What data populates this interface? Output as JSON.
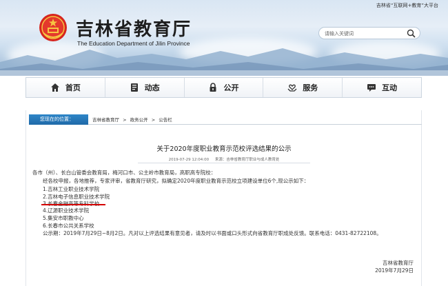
{
  "header": {
    "top_link": "吉林省“互联网+教育”大平台",
    "site_title": "吉林省教育厅",
    "site_subtitle": "The Education Department of Jilin Province",
    "search_placeholder": "请输入关键词"
  },
  "nav": {
    "items": [
      {
        "label": "首页",
        "icon": "home-icon"
      },
      {
        "label": "动态",
        "icon": "document-icon"
      },
      {
        "label": "公开",
        "icon": "lock-icon"
      },
      {
        "label": "服务",
        "icon": "hands-heart-icon"
      },
      {
        "label": "互动",
        "icon": "chat-icon"
      }
    ]
  },
  "breadcrumb": {
    "label": "您现在的位置：",
    "links": [
      "吉林省教育厅",
      "政务公开",
      "公告栏"
    ],
    "separator": ">"
  },
  "article": {
    "title": "关于2020年度职业教育示范校评选结果的公示",
    "date": "2019-07-29 12:04:00",
    "source": "来源：吉林省教育厅职业与成人教育处",
    "salutation": "各市（州）、长白山管委会教育局，梅河口市、公主岭市教育局，高职高专院校：",
    "intro": "经各校申报，各地推荐，专家评审，省教育厅研究，拟确定2020年度职业教育示范校立项建设单位6个,现公示如下：",
    "list": [
      "1.吉林工业职业技术学院",
      "2.吉林电子信息职业技术学院",
      "3.长春金融高等专科学校",
      "4.辽源职业技术学院",
      "5.集安市职教中心",
      "6.长春市公共关系学校"
    ],
    "notice": "公示期：2019年7月29日~8月2日。凡对以上评选结果有意见者，请及时以书面或口头形式向省教育厅职成处反馈。联系电话：0431-82722108。",
    "signer": "吉林省教育厅",
    "sign_date": "2019年7月29日"
  },
  "colors": {
    "accent": "#1f6aa8",
    "underline": "#d40000"
  }
}
